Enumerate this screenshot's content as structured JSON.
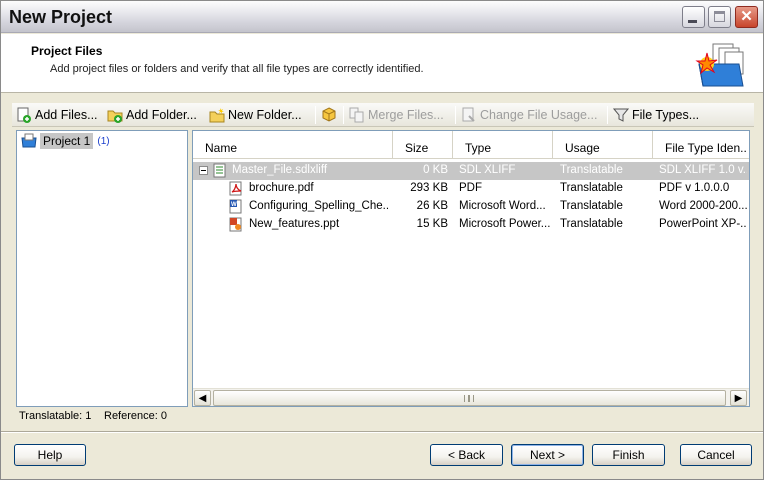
{
  "window": {
    "title": "New Project"
  },
  "header": {
    "title": "Project Files",
    "description": "Add project files or folders and verify that all file types are correctly identified."
  },
  "toolbar": {
    "add_files": "Add Files...",
    "add_folder": "Add Folder...",
    "new_folder": "New Folder...",
    "merge_files": "Merge Files...",
    "change_usage": "Change File Usage...",
    "file_types": "File Types..."
  },
  "tree": {
    "project_label": "Project 1",
    "project_count": "(1)"
  },
  "list": {
    "columns": [
      "Name",
      "Size",
      "Type",
      "Usage",
      "File Type Iden.."
    ],
    "rows": [
      {
        "name": "Master_File.sdlxliff",
        "size": "0 KB",
        "type": "SDL XLIFF",
        "usage": "Translatable",
        "file_type": "SDL XLIFF 1.0 v...",
        "icon": "sdlxliff-icon"
      },
      {
        "name": "brochure.pdf",
        "size": "293 KB",
        "type": "PDF",
        "usage": "Translatable",
        "file_type": "PDF v 1.0.0.0",
        "icon": "pdf-icon"
      },
      {
        "name": "Configuring_Spelling_Che...",
        "size": "26 KB",
        "type": "Microsoft Word...",
        "usage": "Translatable",
        "file_type": "Word 2000-200...",
        "icon": "word-icon"
      },
      {
        "name": "New_features.ppt",
        "size": "15 KB",
        "type": "Microsoft Power...",
        "usage": "Translatable",
        "file_type": "PowerPoint XP-...",
        "icon": "powerpoint-icon"
      }
    ]
  },
  "status": {
    "translatable": "Translatable: 1",
    "reference": "Reference: 0"
  },
  "buttons": {
    "help": "Help",
    "back": "< Back",
    "next": "Next >",
    "finish": "Finish",
    "cancel": "Cancel"
  }
}
